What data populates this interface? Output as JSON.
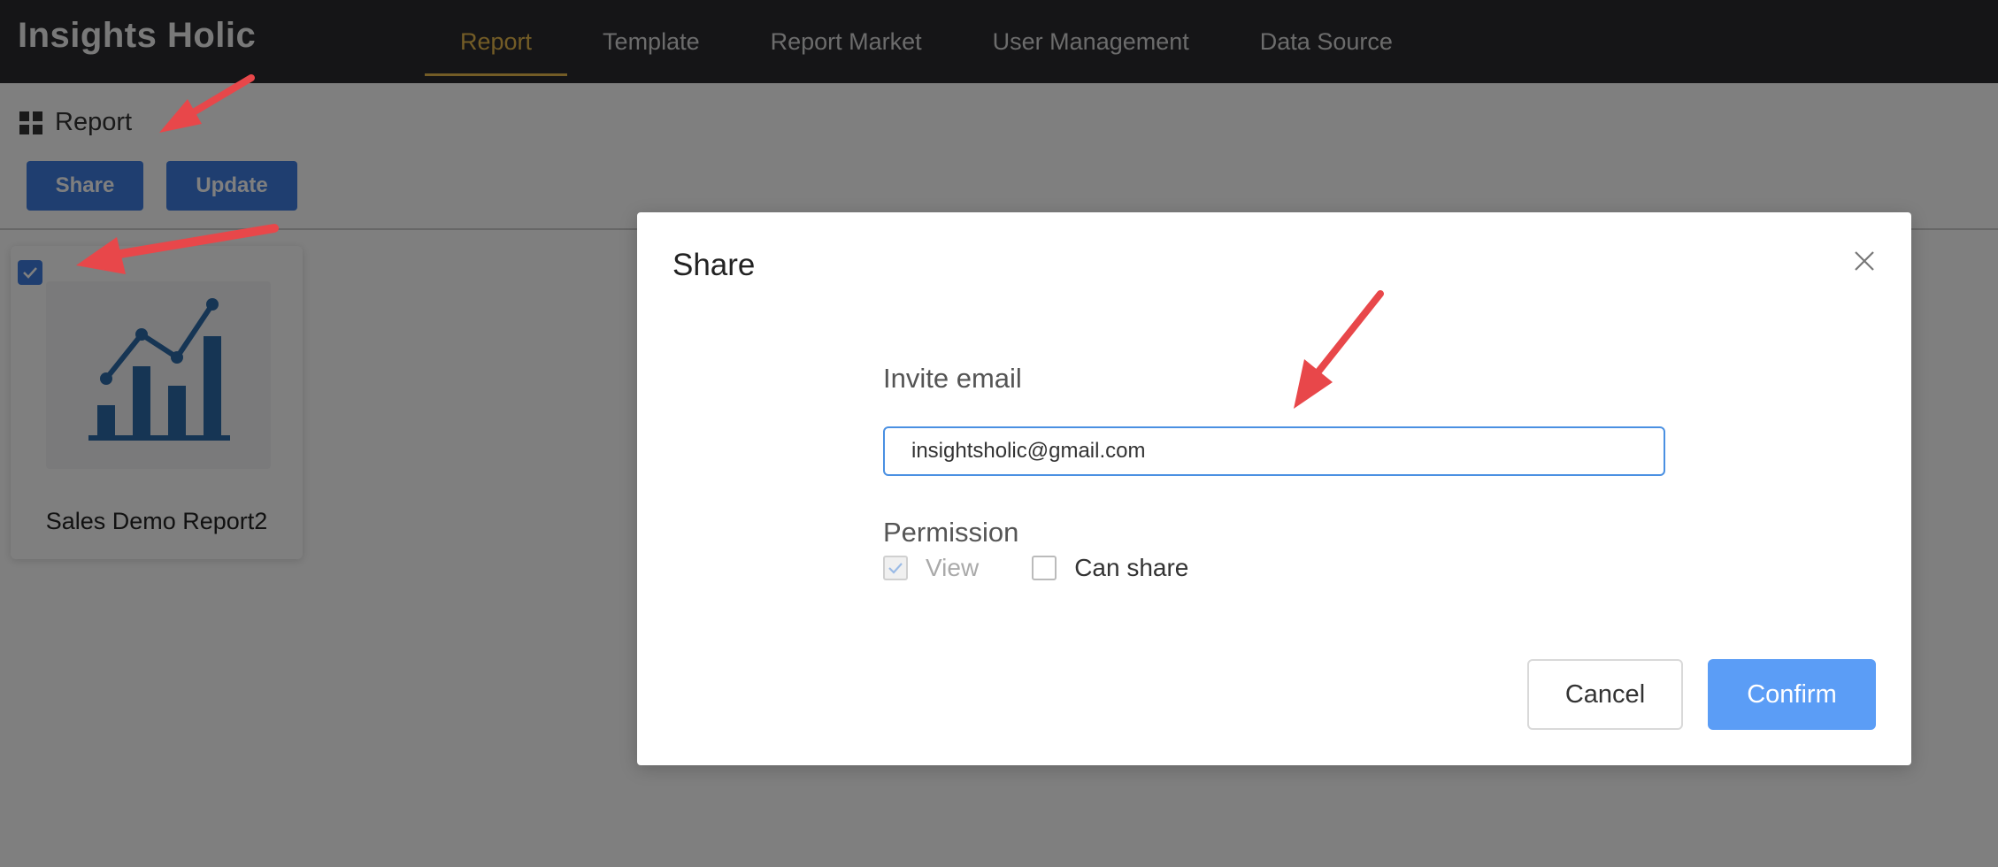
{
  "app": {
    "brand": "Insights Holic"
  },
  "nav": {
    "items": [
      {
        "label": "Report",
        "active": true
      },
      {
        "label": "Template",
        "active": false
      },
      {
        "label": "Report Market",
        "active": false
      },
      {
        "label": "User Management",
        "active": false
      },
      {
        "label": "Data Source",
        "active": false
      }
    ]
  },
  "breadcrumb": {
    "icon": "grid-icon",
    "label": "Report"
  },
  "toolbar": {
    "share_label": "Share",
    "update_label": "Update"
  },
  "report_card": {
    "title": "Sales Demo Report2",
    "selected": true,
    "thumbnail_icon": "bar-line-chart-icon"
  },
  "modal": {
    "title": "Share",
    "email_label": "Invite email",
    "email_value": "insightsholic@gmail.com",
    "permission_label": "Permission",
    "permissions": [
      {
        "label": "View",
        "checked": true,
        "disabled": true
      },
      {
        "label": "Can share",
        "checked": false,
        "disabled": false
      }
    ],
    "cancel_label": "Cancel",
    "confirm_label": "Confirm"
  },
  "colors": {
    "topbar": "#2a2b2f",
    "nav_active": "#e6b94c",
    "primary_button": "#3f7de0",
    "confirm_button": "#5b9df6",
    "annotation_arrow": "#e8474a"
  }
}
